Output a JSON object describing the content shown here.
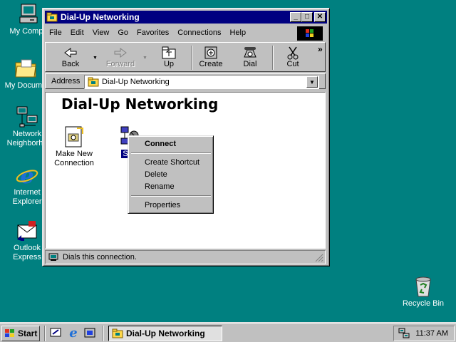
{
  "desktop": {
    "icons": [
      {
        "label": "My Compu",
        "icon": "my-computer-icon"
      },
      {
        "label": "My Docume",
        "icon": "my-documents-icon"
      },
      {
        "label": "Network",
        "label2": "Neighborho",
        "icon": "network-neighborhood-icon"
      },
      {
        "label": "Internet",
        "label2": "Explorer",
        "icon": "internet-explorer-icon"
      },
      {
        "label": "Outlook",
        "label2": "Express",
        "icon": "outlook-express-icon"
      },
      {
        "label": "Recycle Bin",
        "icon": "recycle-bin-icon"
      }
    ]
  },
  "window": {
    "title": "Dial-Up Networking",
    "menu": [
      "File",
      "Edit",
      "View",
      "Go",
      "Favorites",
      "Connections",
      "Help"
    ],
    "toolbar": {
      "back": "Back",
      "forward": "Forward",
      "up": "Up",
      "create": "Create",
      "dial": "Dial",
      "cut": "Cut",
      "more": "»"
    },
    "address": {
      "label": "Address",
      "value": "Dial-Up Networking"
    },
    "folder_title": "Dial-Up Networking",
    "items": [
      {
        "label": "Make New",
        "label2": "Connection"
      },
      {
        "label": "Sop"
      }
    ],
    "status": "Dials this connection."
  },
  "context_menu": {
    "items": [
      "Connect",
      "Create Shortcut",
      "Delete",
      "Rename",
      "Properties"
    ]
  },
  "taskbar": {
    "start": "Start",
    "task": "Dial-Up Networking",
    "clock": "11:37 AM"
  },
  "colors": {
    "desktop": "#008080",
    "titlebar": "#000080",
    "selection": "#000080",
    "face": "#c0c0c0"
  }
}
